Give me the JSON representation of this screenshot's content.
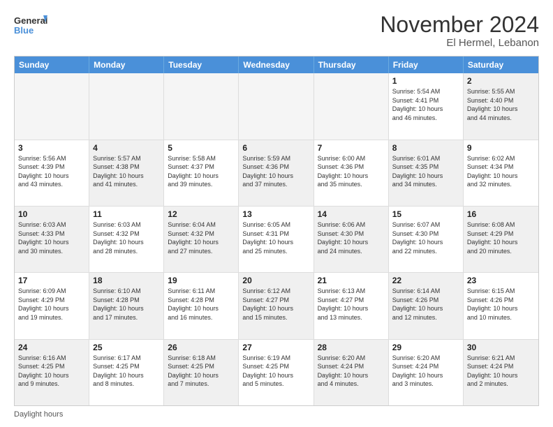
{
  "logo": {
    "line1": "General",
    "line2": "Blue"
  },
  "title": "November 2024",
  "subtitle": "El Hermel, Lebanon",
  "days_of_week": [
    "Sunday",
    "Monday",
    "Tuesday",
    "Wednesday",
    "Thursday",
    "Friday",
    "Saturday"
  ],
  "footer": "Daylight hours",
  "weeks": [
    [
      {
        "day": "",
        "info": "",
        "empty": true
      },
      {
        "day": "",
        "info": "",
        "empty": true
      },
      {
        "day": "",
        "info": "",
        "empty": true
      },
      {
        "day": "",
        "info": "",
        "empty": true
      },
      {
        "day": "",
        "info": "",
        "empty": true
      },
      {
        "day": "1",
        "info": "Sunrise: 5:54 AM\nSunset: 4:41 PM\nDaylight: 10 hours\nand 46 minutes."
      },
      {
        "day": "2",
        "info": "Sunrise: 5:55 AM\nSunset: 4:40 PM\nDaylight: 10 hours\nand 44 minutes.",
        "shaded": true
      }
    ],
    [
      {
        "day": "3",
        "info": "Sunrise: 5:56 AM\nSunset: 4:39 PM\nDaylight: 10 hours\nand 43 minutes."
      },
      {
        "day": "4",
        "info": "Sunrise: 5:57 AM\nSunset: 4:38 PM\nDaylight: 10 hours\nand 41 minutes.",
        "shaded": true
      },
      {
        "day": "5",
        "info": "Sunrise: 5:58 AM\nSunset: 4:37 PM\nDaylight: 10 hours\nand 39 minutes."
      },
      {
        "day": "6",
        "info": "Sunrise: 5:59 AM\nSunset: 4:36 PM\nDaylight: 10 hours\nand 37 minutes.",
        "shaded": true
      },
      {
        "day": "7",
        "info": "Sunrise: 6:00 AM\nSunset: 4:36 PM\nDaylight: 10 hours\nand 35 minutes."
      },
      {
        "day": "8",
        "info": "Sunrise: 6:01 AM\nSunset: 4:35 PM\nDaylight: 10 hours\nand 34 minutes.",
        "shaded": true
      },
      {
        "day": "9",
        "info": "Sunrise: 6:02 AM\nSunset: 4:34 PM\nDaylight: 10 hours\nand 32 minutes."
      }
    ],
    [
      {
        "day": "10",
        "info": "Sunrise: 6:03 AM\nSunset: 4:33 PM\nDaylight: 10 hours\nand 30 minutes.",
        "shaded": true
      },
      {
        "day": "11",
        "info": "Sunrise: 6:03 AM\nSunset: 4:32 PM\nDaylight: 10 hours\nand 28 minutes."
      },
      {
        "day": "12",
        "info": "Sunrise: 6:04 AM\nSunset: 4:32 PM\nDaylight: 10 hours\nand 27 minutes.",
        "shaded": true
      },
      {
        "day": "13",
        "info": "Sunrise: 6:05 AM\nSunset: 4:31 PM\nDaylight: 10 hours\nand 25 minutes."
      },
      {
        "day": "14",
        "info": "Sunrise: 6:06 AM\nSunset: 4:30 PM\nDaylight: 10 hours\nand 24 minutes.",
        "shaded": true
      },
      {
        "day": "15",
        "info": "Sunrise: 6:07 AM\nSunset: 4:30 PM\nDaylight: 10 hours\nand 22 minutes."
      },
      {
        "day": "16",
        "info": "Sunrise: 6:08 AM\nSunset: 4:29 PM\nDaylight: 10 hours\nand 20 minutes.",
        "shaded": true
      }
    ],
    [
      {
        "day": "17",
        "info": "Sunrise: 6:09 AM\nSunset: 4:29 PM\nDaylight: 10 hours\nand 19 minutes."
      },
      {
        "day": "18",
        "info": "Sunrise: 6:10 AM\nSunset: 4:28 PM\nDaylight: 10 hours\nand 17 minutes.",
        "shaded": true
      },
      {
        "day": "19",
        "info": "Sunrise: 6:11 AM\nSunset: 4:28 PM\nDaylight: 10 hours\nand 16 minutes."
      },
      {
        "day": "20",
        "info": "Sunrise: 6:12 AM\nSunset: 4:27 PM\nDaylight: 10 hours\nand 15 minutes.",
        "shaded": true
      },
      {
        "day": "21",
        "info": "Sunrise: 6:13 AM\nSunset: 4:27 PM\nDaylight: 10 hours\nand 13 minutes."
      },
      {
        "day": "22",
        "info": "Sunrise: 6:14 AM\nSunset: 4:26 PM\nDaylight: 10 hours\nand 12 minutes.",
        "shaded": true
      },
      {
        "day": "23",
        "info": "Sunrise: 6:15 AM\nSunset: 4:26 PM\nDaylight: 10 hours\nand 10 minutes."
      }
    ],
    [
      {
        "day": "24",
        "info": "Sunrise: 6:16 AM\nSunset: 4:25 PM\nDaylight: 10 hours\nand 9 minutes.",
        "shaded": true
      },
      {
        "day": "25",
        "info": "Sunrise: 6:17 AM\nSunset: 4:25 PM\nDaylight: 10 hours\nand 8 minutes."
      },
      {
        "day": "26",
        "info": "Sunrise: 6:18 AM\nSunset: 4:25 PM\nDaylight: 10 hours\nand 7 minutes.",
        "shaded": true
      },
      {
        "day": "27",
        "info": "Sunrise: 6:19 AM\nSunset: 4:25 PM\nDaylight: 10 hours\nand 5 minutes."
      },
      {
        "day": "28",
        "info": "Sunrise: 6:20 AM\nSunset: 4:24 PM\nDaylight: 10 hours\nand 4 minutes.",
        "shaded": true
      },
      {
        "day": "29",
        "info": "Sunrise: 6:20 AM\nSunset: 4:24 PM\nDaylight: 10 hours\nand 3 minutes."
      },
      {
        "day": "30",
        "info": "Sunrise: 6:21 AM\nSunset: 4:24 PM\nDaylight: 10 hours\nand 2 minutes.",
        "shaded": true
      }
    ]
  ]
}
